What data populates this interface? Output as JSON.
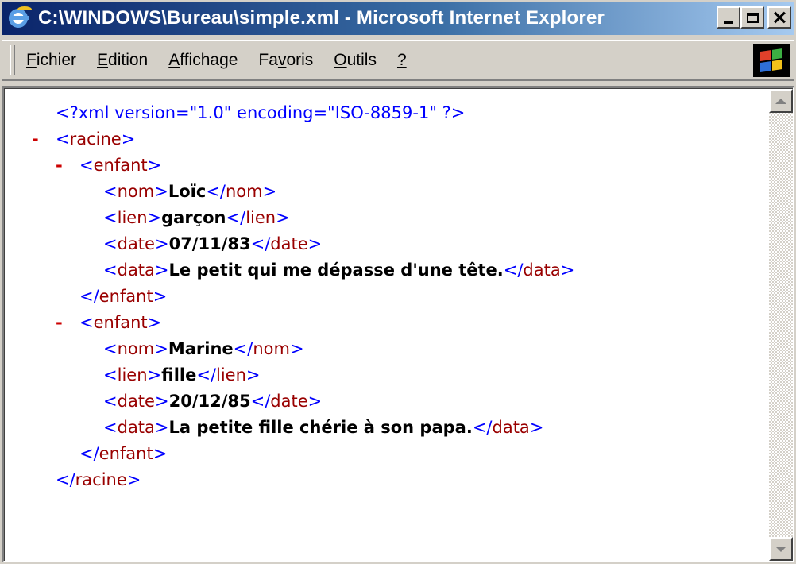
{
  "window": {
    "title": "C:\\WINDOWS\\Bureau\\simple.xml - Microsoft Internet Explorer",
    "icon": "internet-explorer-icon",
    "controls": {
      "minimize": "minimize-icon",
      "maximize": "maximize-icon",
      "close": "close-icon"
    }
  },
  "menubar": {
    "items": [
      {
        "pre": "",
        "acc": "F",
        "post": "ichier"
      },
      {
        "pre": "",
        "acc": "E",
        "post": "dition"
      },
      {
        "pre": "",
        "acc": "A",
        "post": "ffichage"
      },
      {
        "pre": "Fa",
        "acc": "v",
        "post": "oris"
      },
      {
        "pre": "",
        "acc": "O",
        "post": "utils"
      },
      {
        "pre": "",
        "acc": "?",
        "post": ""
      }
    ],
    "throbber_icon": "windows-logo-icon"
  },
  "colors": {
    "markup": "#0000ff",
    "tag_name": "#990000",
    "collapse": "#cc0000",
    "value": "#000000"
  },
  "document": {
    "declaration": "<?xml version=\"1.0\" encoding=\"ISO-8859-1\" ?>",
    "collapse_marker": "-",
    "lt": "<",
    "gt": ">",
    "lt_slash": "</",
    "root_tag": "racine",
    "child_tag": "enfant",
    "field_tags": [
      "nom",
      "lien",
      "date",
      "data"
    ],
    "children": [
      {
        "nom": "Loïc",
        "lien": "garçon",
        "date": "07/11/83",
        "data": "Le petit qui me dépasse d'une tête."
      },
      {
        "nom": "Marine",
        "lien": "fille",
        "date": "20/12/85",
        "data": "La petite fille chérie à son papa."
      }
    ]
  }
}
